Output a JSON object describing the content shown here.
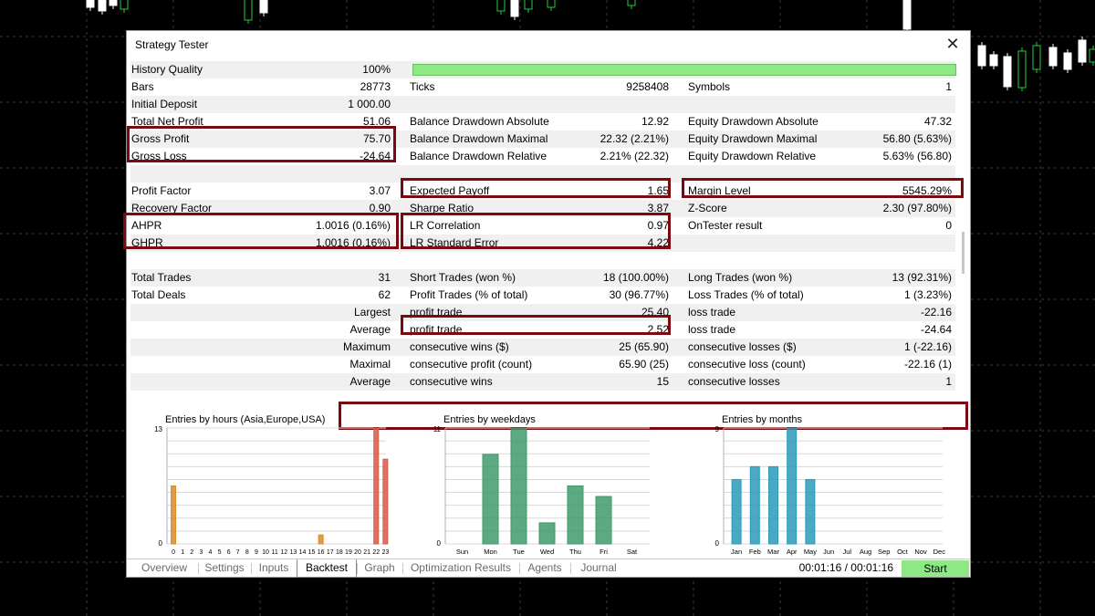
{
  "window": {
    "title": "Strategy Tester"
  },
  "colors": {
    "progress": "#8ee886",
    "highlight": "#7a0a10",
    "hours_bars": "#d98b2b",
    "hours_bars_late": "#d65a4a",
    "weekday_bars": "#3f9a6c",
    "month_bars": "#2a9bb8"
  },
  "report": {
    "rows": [
      {
        "shade": true,
        "c1": [
          "History Quality",
          "100%"
        ],
        "c2": [
          "",
          ""
        ],
        "c3": [
          "",
          ""
        ],
        "bar": true
      },
      {
        "shade": false,
        "c1": [
          "Bars",
          "28773"
        ],
        "c2": [
          "Ticks",
          "9258408"
        ],
        "c3": [
          "Symbols",
          "1"
        ]
      },
      {
        "shade": true,
        "c1": [
          "Initial Deposit",
          "1 000.00"
        ],
        "c2": [
          "",
          ""
        ],
        "c3": [
          "",
          ""
        ]
      },
      {
        "shade": false,
        "c1": [
          "Total Net Profit",
          "51.06"
        ],
        "c2": [
          "Balance Drawdown Absolute",
          "12.92"
        ],
        "c3": [
          "Equity Drawdown Absolute",
          "47.32"
        ]
      },
      {
        "shade": true,
        "c1": [
          "Gross Profit",
          "75.70"
        ],
        "c2": [
          "Balance Drawdown Maximal",
          "22.32 (2.21%)"
        ],
        "c3": [
          "Equity Drawdown Maximal",
          "56.80 (5.63%)"
        ]
      },
      {
        "shade": false,
        "c1": [
          "Gross Loss",
          "-24.64"
        ],
        "c2": [
          "Balance Drawdown Relative",
          "2.21% (22.32)"
        ],
        "c3": [
          "Equity Drawdown Relative",
          "5.63% (56.80)"
        ]
      },
      {
        "shade": true,
        "c1": [
          "",
          ""
        ],
        "c2": [
          "",
          ""
        ],
        "c3": [
          "",
          ""
        ]
      },
      {
        "shade": false,
        "c1": [
          "Profit Factor",
          "3.07"
        ],
        "c2": [
          "Expected Payoff",
          "1.65"
        ],
        "c3": [
          "Margin Level",
          "5545.29%"
        ]
      },
      {
        "shade": true,
        "c1": [
          "Recovery Factor",
          "0.90"
        ],
        "c2": [
          "Sharpe Ratio",
          "3.87"
        ],
        "c3": [
          "Z-Score",
          "2.30 (97.80%)"
        ]
      },
      {
        "shade": false,
        "c1": [
          "AHPR",
          "1.0016 (0.16%)"
        ],
        "c2": [
          "LR Correlation",
          "0.97"
        ],
        "c3": [
          "OnTester result",
          "0"
        ]
      },
      {
        "shade": true,
        "c1": [
          "GHPR",
          "1.0016 (0.16%)"
        ],
        "c2": [
          "LR Standard Error",
          "4.22"
        ],
        "c3": [
          "",
          ""
        ]
      },
      {
        "shade": false,
        "c1": [
          "",
          ""
        ],
        "c2": [
          "",
          ""
        ],
        "c3": [
          "",
          ""
        ]
      },
      {
        "shade": true,
        "c1": [
          "Total Trades",
          "31"
        ],
        "c2": [
          "Short Trades (won %)",
          "18 (100.00%)"
        ],
        "c3": [
          "Long Trades (won %)",
          "13 (92.31%)"
        ]
      },
      {
        "shade": false,
        "c1": [
          "Total Deals",
          "62"
        ],
        "c2": [
          "Profit Trades (% of total)",
          "30 (96.77%)"
        ],
        "c3": [
          "Loss Trades (% of total)",
          "1 (3.23%)"
        ]
      },
      {
        "shade": true,
        "c1": [
          "",
          "Largest"
        ],
        "c2": [
          "profit trade",
          "25.40"
        ],
        "c3": [
          "loss trade",
          "-22.16"
        ]
      },
      {
        "shade": false,
        "c1": [
          "",
          "Average"
        ],
        "c2": [
          "profit trade",
          "2.52"
        ],
        "c3": [
          "loss trade",
          "-24.64"
        ]
      },
      {
        "shade": true,
        "c1": [
          "",
          "Maximum"
        ],
        "c2": [
          "consecutive wins ($)",
          "25 (65.90)"
        ],
        "c3": [
          "consecutive losses ($)",
          "1 (-22.16)"
        ]
      },
      {
        "shade": false,
        "c1": [
          "",
          "Maximal"
        ],
        "c2": [
          "consecutive profit (count)",
          "65.90 (25)"
        ],
        "c3": [
          "consecutive loss (count)",
          "-22.16 (1)"
        ]
      },
      {
        "shade": true,
        "c1": [
          "",
          "Average"
        ],
        "c2": [
          "consecutive wins",
          "15"
        ],
        "c3": [
          "consecutive losses",
          "1"
        ]
      }
    ]
  },
  "chart_data": [
    {
      "type": "bar",
      "title": "Entries by hours (Asia,Europe,USA)",
      "categories": [
        "0",
        "1",
        "2",
        "3",
        "4",
        "5",
        "6",
        "7",
        "8",
        "9",
        "10",
        "11",
        "12",
        "13",
        "14",
        "15",
        "16",
        "17",
        "18",
        "19",
        "20",
        "21",
        "22",
        "23"
      ],
      "values": [
        6.5,
        0,
        0,
        0,
        0,
        0,
        0,
        0,
        0,
        0,
        0,
        0,
        0,
        0,
        0,
        0,
        1,
        0,
        0,
        0,
        0,
        0,
        13,
        9.5
      ],
      "ylim": [
        0,
        13
      ],
      "ytick_labels": [
        "13",
        "0"
      ]
    },
    {
      "type": "bar",
      "title": "Entries by weekdays",
      "categories": [
        "Sun",
        "Mon",
        "Tue",
        "Wed",
        "Thu",
        "Fri",
        "Sat"
      ],
      "values": [
        0,
        8.5,
        11,
        2,
        5.5,
        4.5,
        0
      ],
      "ylim": [
        0,
        11
      ],
      "ytick_labels": [
        "11",
        "0"
      ]
    },
    {
      "type": "bar",
      "title": "Entries by months",
      "categories": [
        "Jan",
        "Feb",
        "Mar",
        "Apr",
        "May",
        "Jun",
        "Jul",
        "Aug",
        "Sep",
        "Oct",
        "Nov",
        "Dec"
      ],
      "values": [
        5,
        6,
        6,
        9,
        5,
        0,
        0,
        0,
        0,
        0,
        0,
        0
      ],
      "ylim": [
        0,
        9
      ],
      "ytick_labels": [
        "9",
        "0"
      ]
    }
  ],
  "tabs": [
    "Overview",
    "Settings",
    "Inputs",
    "Backtest",
    "Graph",
    "Optimization Results",
    "Agents",
    "Journal"
  ],
  "active_tab": "Backtest",
  "status": {
    "timer": "00:01:16 / 00:01:16",
    "start_label": "Start"
  }
}
